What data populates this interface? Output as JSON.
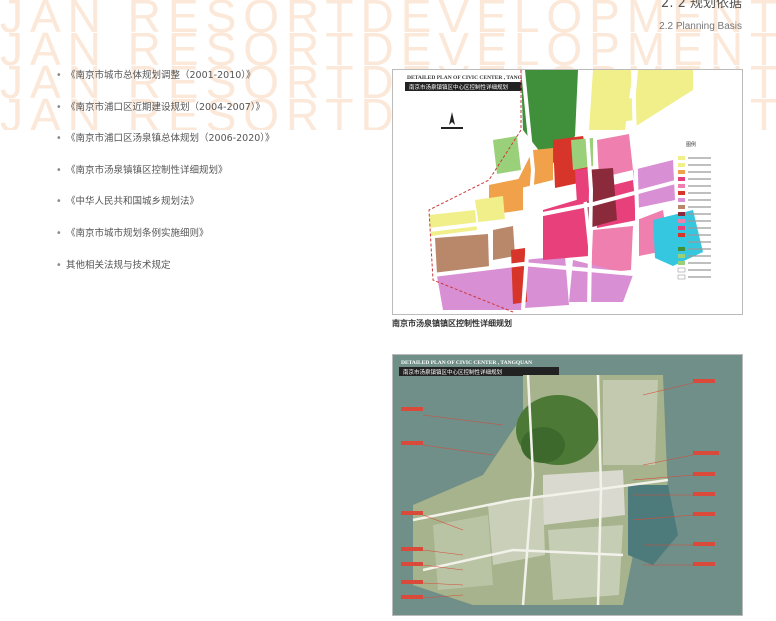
{
  "watermark": {
    "lines": [
      "JAN RESORTDEVELOPMENT",
      "JAN RESORTDEVELOPMENT",
      "JAN RESORTDEVELOPMENT",
      "JAN RESORTDEVELOPMENT"
    ]
  },
  "header": {
    "title": "2. 2  规划依据",
    "subtitle": "2.2 Planning Basis"
  },
  "basis_list": [
    "《南京市城市总体规划调整（2001-2010）》",
    "《南京市浦口区近期建设规划（2004-2007）》",
    "《南京市浦口区汤泉镇总体规划（2006-2020）》",
    "《南京市汤泉镇镇区控制性详细规划》",
    "《中华人民共和国城乡规划法》",
    "《南京市城市规划条例实施细则》",
    "其他相关法规与技术规定"
  ],
  "bullet": "•",
  "map1": {
    "title_en": "DETAILED PLAN OF CIVIC CENTER , TANGQUAN",
    "title_cn": "南京市汤泉镇镇区中心区控制性详细规划",
    "legend_title": "图例",
    "caption": "南京市汤泉镇镇区控制性详细规划",
    "colors": {
      "residential": "#f0ef8a",
      "commercial": "#e8407a",
      "pink": "#ef7fae",
      "school": "#d88fd4",
      "green": "#3f8f3b",
      "lightgreen": "#9bd07a",
      "water": "#35c7e0",
      "orange": "#f0a14a",
      "brown": "#b9876a",
      "red": "#d8352a"
    }
  },
  "map2": {
    "title_en": "DETAILED PLAN OF CIVIC CENTER , TANGQUAN",
    "title_cn": "南京市汤泉镇镇区中心区控制性详细规划"
  }
}
